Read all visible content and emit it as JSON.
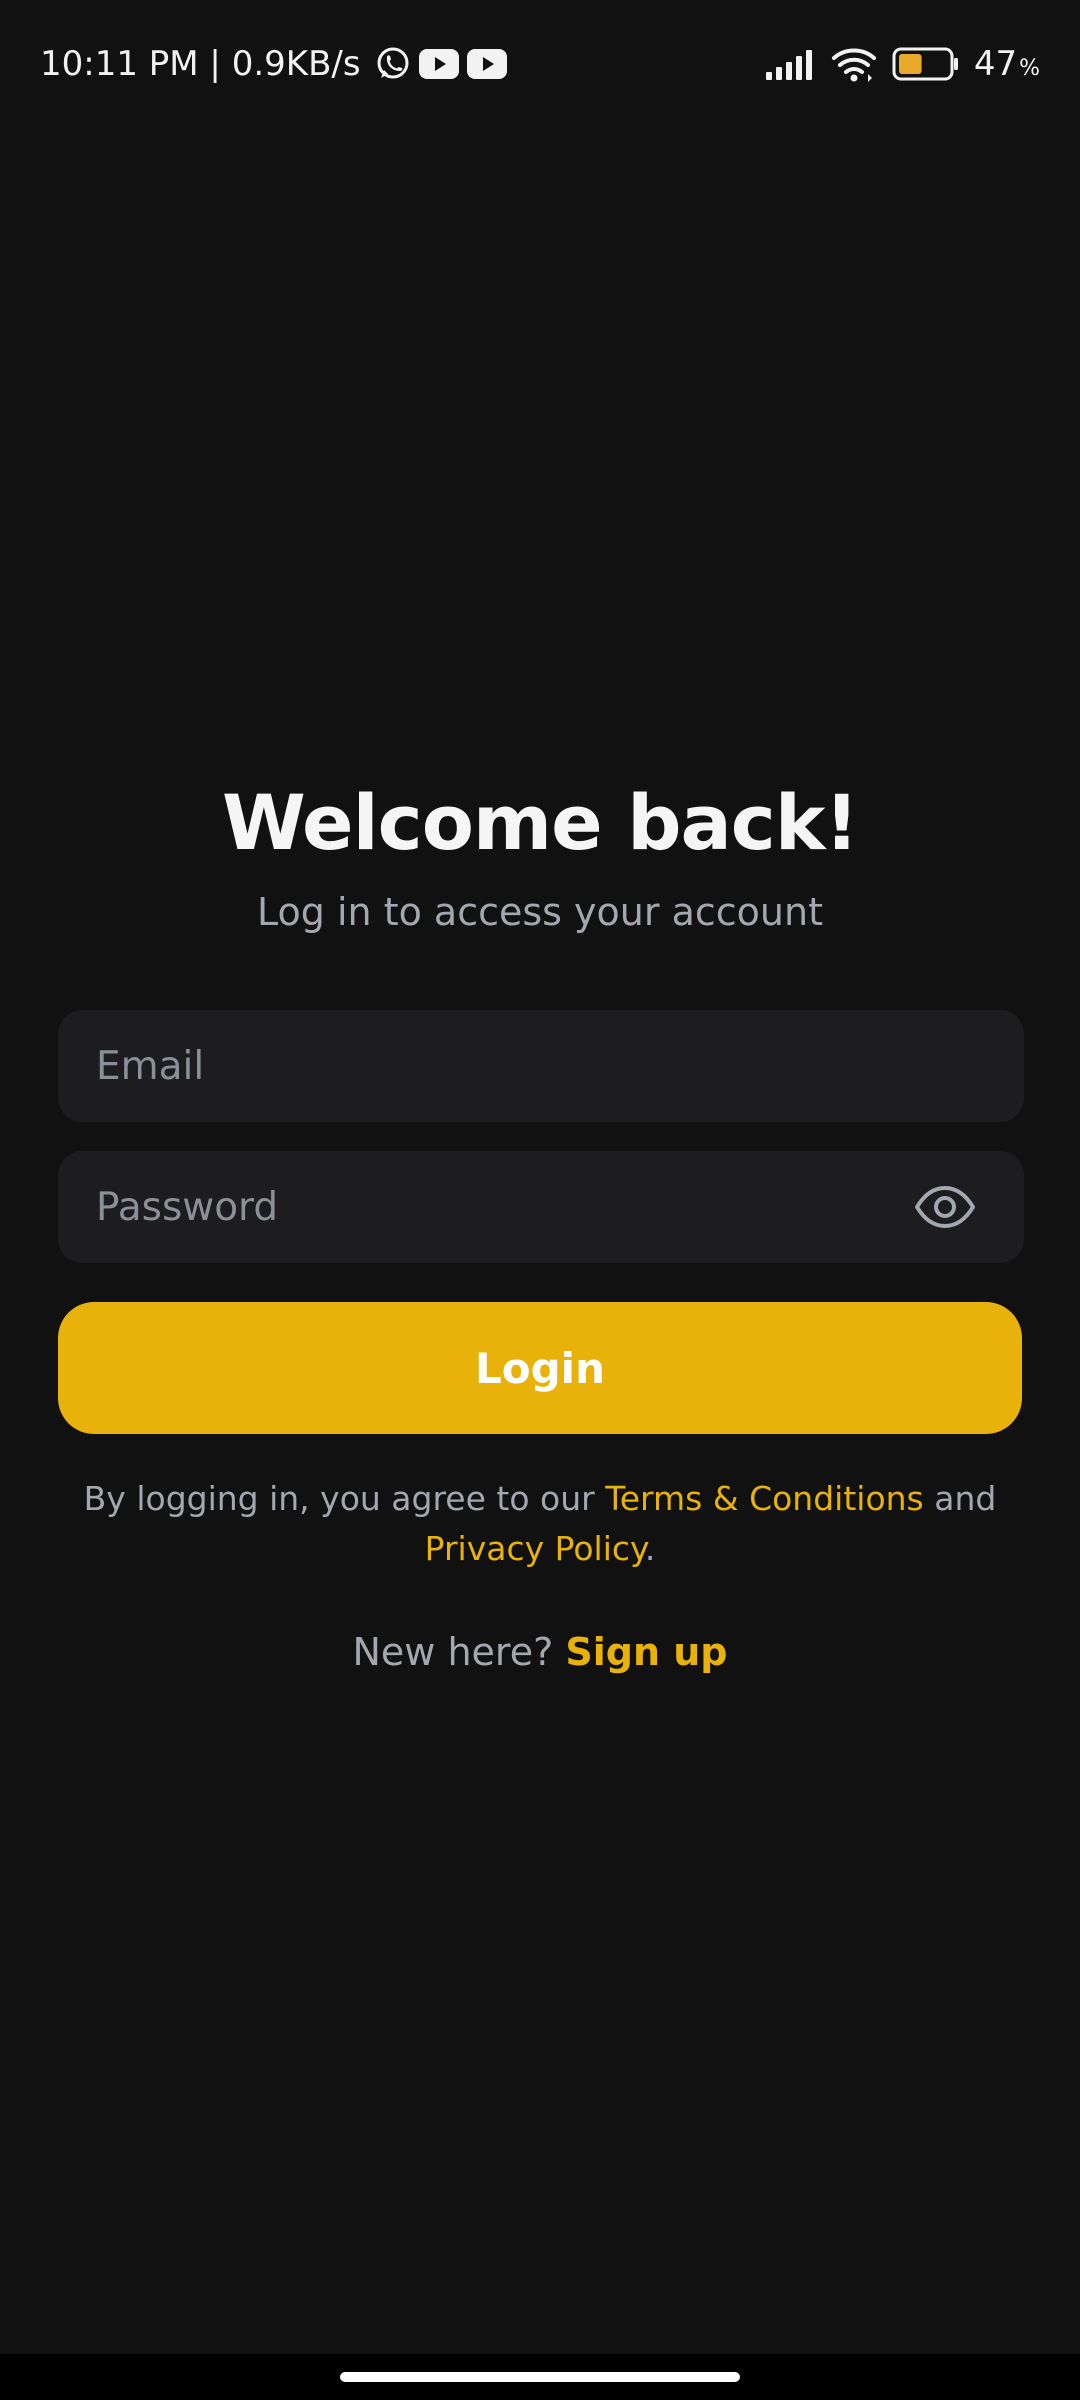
{
  "status_bar": {
    "time_speed": "10:11 PM | 0.9KB/s",
    "notification_icons": [
      "whatsapp-icon",
      "youtube-icon",
      "youtube-icon"
    ],
    "system_icons": [
      "signal-icon",
      "wifi-icon",
      "battery-icon"
    ],
    "battery_level": 47,
    "battery_value": "47",
    "battery_unit": "%",
    "battery_color": "#e8a82a"
  },
  "login": {
    "title": "Welcome back!",
    "subtitle": "Log in to access your account",
    "email_placeholder": "Email",
    "email_value": "",
    "password_placeholder": "Password",
    "password_value": "",
    "login_label": "Login",
    "terms": {
      "prefix": "By logging in, you agree to our ",
      "terms_link": "Terms & Conditions",
      "connector": " and ",
      "privacy_link": "Privacy Policy",
      "suffix": "."
    },
    "signup_prompt": "New here? ",
    "signup_link": "Sign up"
  },
  "colors": {
    "background": "#111111",
    "accent": "#e8b20a",
    "field_bg": "#1d1d1f",
    "muted_text": "#a3a7b0"
  }
}
